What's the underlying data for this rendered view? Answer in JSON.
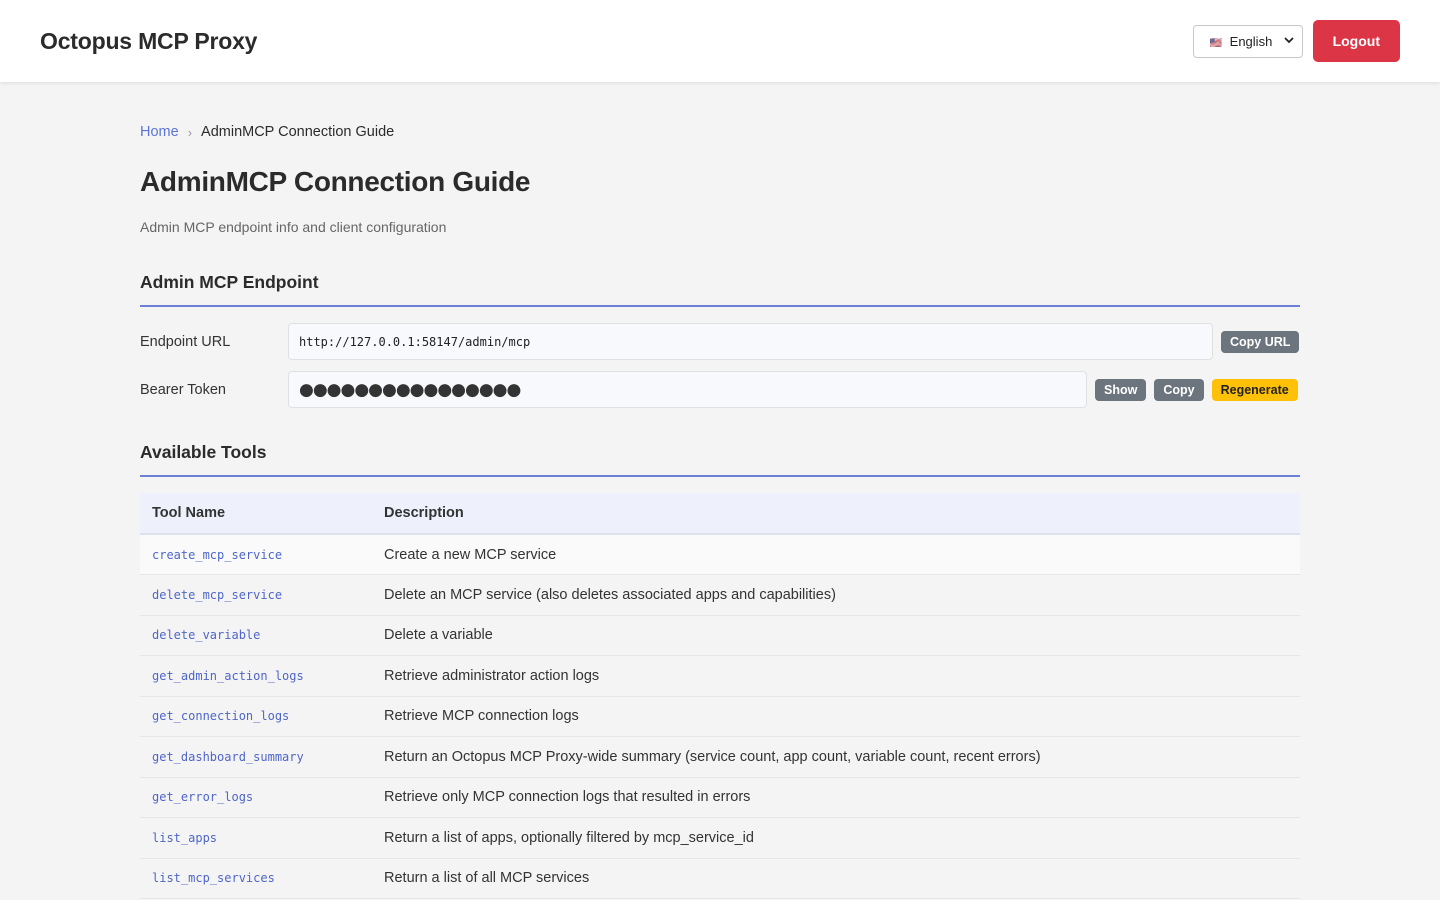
{
  "header": {
    "brand": "Octopus MCP Proxy",
    "language": {
      "flag": "🇺🇸",
      "selected": "English"
    },
    "logout_label": "Logout"
  },
  "breadcrumb": {
    "home": "Home",
    "current": "AdminMCP Connection Guide"
  },
  "page": {
    "title": "AdminMCP Connection Guide",
    "subtitle": "Admin MCP endpoint info and client configuration"
  },
  "endpoint": {
    "section_title": "Admin MCP Endpoint",
    "url_label": "Endpoint URL",
    "url_value": "http://127.0.0.1:58147/admin/mcp",
    "copy_url_label": "Copy URL",
    "token_label": "Bearer Token",
    "token_masked": "●●●●●●●●●●●●●●●●",
    "show_label": "Show",
    "copy_label": "Copy",
    "regenerate_label": "Regenerate"
  },
  "tools": {
    "section_title": "Available Tools",
    "columns": [
      "Tool Name",
      "Description"
    ],
    "rows": [
      {
        "name": "create_mcp_service",
        "description": "Create a new MCP service"
      },
      {
        "name": "delete_mcp_service",
        "description": "Delete an MCP service (also deletes associated apps and capabilities)"
      },
      {
        "name": "delete_variable",
        "description": "Delete a variable"
      },
      {
        "name": "get_admin_action_logs",
        "description": "Retrieve administrator action logs"
      },
      {
        "name": "get_connection_logs",
        "description": "Retrieve MCP connection logs"
      },
      {
        "name": "get_dashboard_summary",
        "description": "Return an Octopus MCP Proxy-wide summary (service count, app count, variable count, recent errors)"
      },
      {
        "name": "get_error_logs",
        "description": "Retrieve only MCP connection logs that resulted in errors"
      },
      {
        "name": "list_apps",
        "description": "Return a list of apps, optionally filtered by mcp_service_id"
      },
      {
        "name": "list_mcp_services",
        "description": "Return a list of all MCP services"
      }
    ]
  },
  "colors": {
    "accent": "#5b73d6",
    "logout": "#dc3545",
    "regenerate": "#ffc107",
    "secondary_button": "#6c757d"
  }
}
